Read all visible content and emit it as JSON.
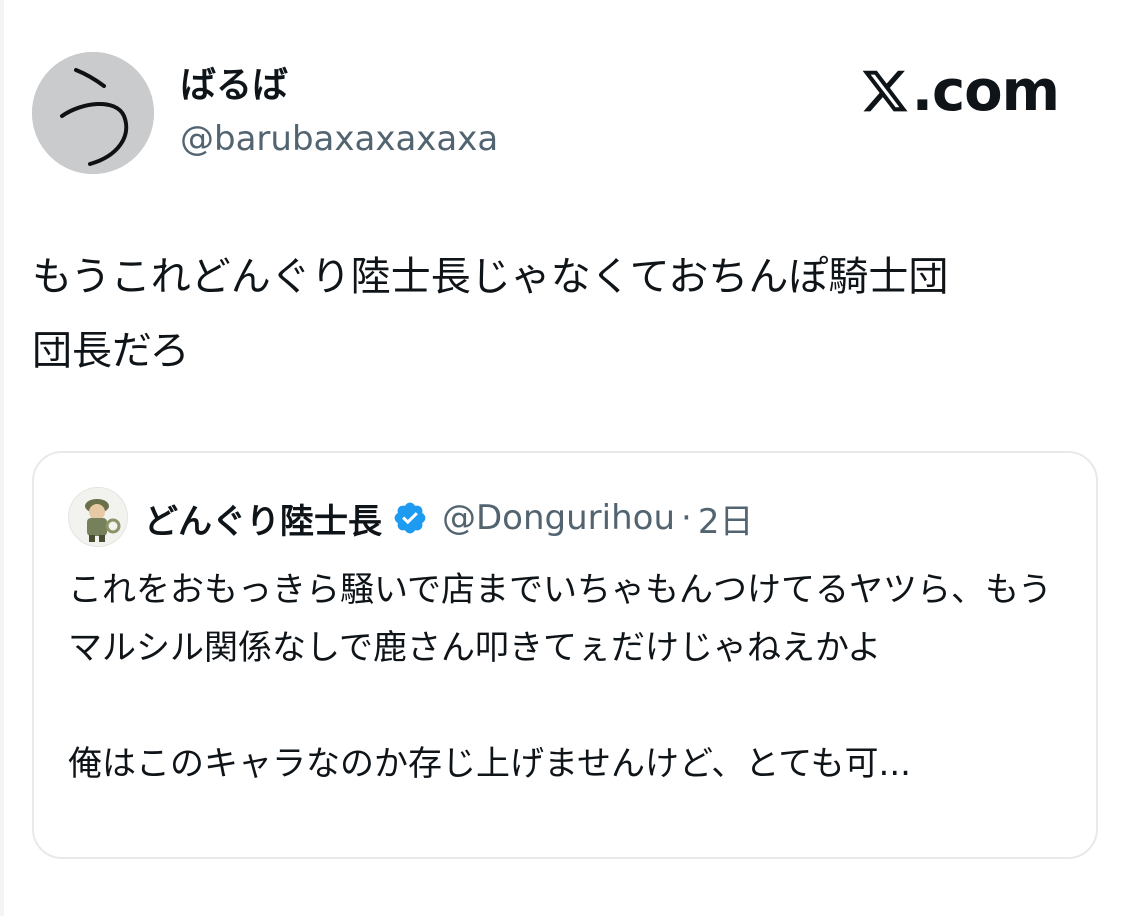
{
  "author": {
    "display_name": "ばるば",
    "handle": "@barubaxaxaxaxa",
    "avatar_icon": "hiragana-u-avatar-icon"
  },
  "brand": {
    "label": ".com",
    "icon": "x-logo-icon"
  },
  "tweet": {
    "text": "もうこれどんぐり陸士長じゃなくておちんぽ騎士団\n団長だろ"
  },
  "quote": {
    "display_name": "どんぐり陸士長",
    "verified_icon": "verified-badge-icon",
    "handle": "@Dongurihou",
    "dot": "·",
    "time": "2日",
    "text": "これをおもっきら騒いで店までいちゃもんつけてるヤツら、もうマルシル関係なしで鹿さん叩きてぇだけじゃねえかよ\n\n俺はこのキャラなのか存じ上げませんけど、とても可..."
  },
  "colors": {
    "text_primary": "#0f1419",
    "text_secondary": "#536471",
    "border": "#e7e9ea",
    "verified": "#1d9bf0",
    "avatar_bg": "#c9cbcd"
  }
}
